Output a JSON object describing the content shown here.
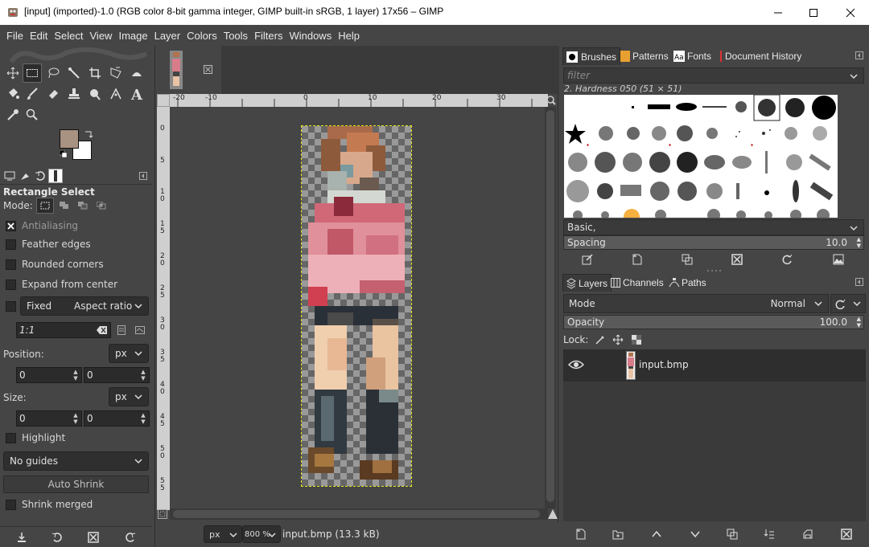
{
  "window": {
    "title": "[input] (imported)-1.0 (RGB color 8-bit gamma integer, GIMP built-in sRGB, 1 layer) 17x56 – GIMP"
  },
  "menu": [
    "File",
    "Edit",
    "Select",
    "View",
    "Image",
    "Layer",
    "Colors",
    "Tools",
    "Filters",
    "Windows",
    "Help"
  ],
  "tool_options": {
    "title": "Rectangle Select",
    "mode_label": "Mode:",
    "antialiasing": "Antialiasing",
    "feather_edges": "Feather edges",
    "rounded_corners": "Rounded corners",
    "expand_from_center": "Expand from center",
    "fixed_label": "Fixed",
    "fixed_mode": "Aspect ratio",
    "ratio_value": "1:1",
    "position_label": "Position:",
    "position_unit": "px",
    "position_x": "0",
    "position_y": "0",
    "size_label": "Size:",
    "size_unit": "px",
    "size_w": "0",
    "size_h": "0",
    "highlight": "Highlight",
    "guides": "No guides",
    "auto_shrink": "Auto Shrink",
    "shrink_merged": "Shrink merged"
  },
  "colors": {
    "foreground": "#a89282",
    "background": "#ffffff",
    "selection_outline": "#e8e81a"
  },
  "ruler": {
    "h_labels": [
      "-20",
      "-10",
      "0",
      "10",
      "20",
      "30"
    ],
    "v_labels": [
      "0",
      "5",
      "1 0",
      "1 5",
      "2 0",
      "2 5",
      "3 0",
      "3 5",
      "4 0",
      "4 5",
      "5 0",
      "5 5"
    ]
  },
  "status": {
    "unit": "px",
    "zoom": "800 %",
    "file": "input.bmp (13.3 kB)"
  },
  "brushes_panel": {
    "tabs": [
      "Brushes",
      "Patterns",
      "Fonts",
      "Document History"
    ],
    "filter_placeholder": "filter",
    "current_brush": "2. Hardness 050 (51 × 51)",
    "tag": "Basic,",
    "spacing_label": "Spacing",
    "spacing_value": "10.0"
  },
  "layers_panel": {
    "tabs": [
      "Layers",
      "Channels",
      "Paths"
    ],
    "mode_label": "Mode",
    "mode_value": "Normal",
    "opacity_label": "Opacity",
    "opacity_value": "100.0",
    "lock_label": "Lock:",
    "layers": [
      {
        "name": "input.bmp",
        "visible": true
      }
    ]
  }
}
